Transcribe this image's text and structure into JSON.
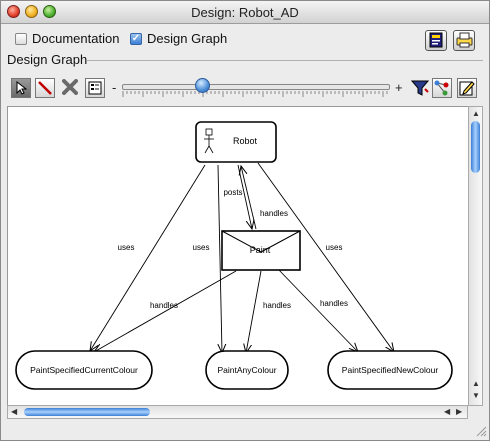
{
  "window": {
    "title": "Design: Robot_AD"
  },
  "top_options": {
    "documentation_label": "Documentation",
    "documentation_checked": false,
    "design_graph_label": "Design Graph",
    "design_graph_checked": true,
    "right_icons": [
      "print-preview-icon",
      "print-icon"
    ]
  },
  "section": {
    "label": "Design Graph"
  },
  "toolbar": {
    "tools": [
      "select-arrow-icon",
      "draw-line-icon",
      "delete-x-icon",
      "properties-icon"
    ],
    "zoom_minus": "-",
    "zoom_plus": "+",
    "zoom_level": 0.3,
    "right_tools": [
      "filter-icon",
      "layout-graph-icon",
      "edit-icon"
    ]
  },
  "graph": {
    "nodes": {
      "robot": "Robot",
      "paint": "Paint",
      "current": "PaintSpecifiedCurrentColour",
      "any": "PaintAnyColour",
      "new": "PaintSpecifiedNewColour"
    },
    "edge_labels": {
      "uses_left": "uses",
      "uses_mid": "uses",
      "uses_right": "uses",
      "posts": "posts",
      "handles_robot": "handles",
      "handles_left": "handles",
      "handles_mid": "handles",
      "handles_right": "handles"
    }
  },
  "colors": {
    "accent": "#3b7fd5"
  }
}
